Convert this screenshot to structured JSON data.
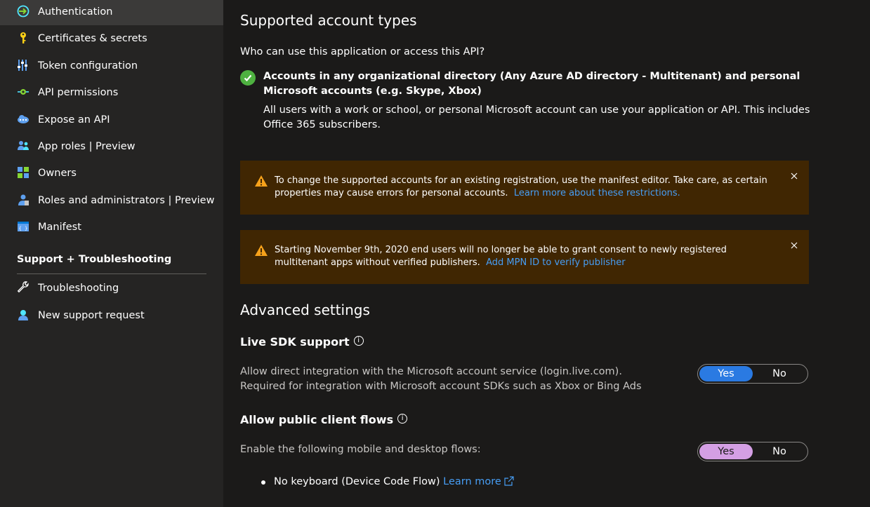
{
  "sidebar": {
    "items": [
      {
        "label": "Authentication",
        "icon": "authentication-icon"
      },
      {
        "label": "Certificates & secrets",
        "icon": "key-icon"
      },
      {
        "label": "Token configuration",
        "icon": "token-bars-icon"
      },
      {
        "label": "API permissions",
        "icon": "api-permissions-icon"
      },
      {
        "label": "Expose an API",
        "icon": "cloud-icon"
      },
      {
        "label": "App roles | Preview",
        "icon": "app-roles-icon"
      },
      {
        "label": "Owners",
        "icon": "owners-grid-icon"
      },
      {
        "label": "Roles and administrators | Preview",
        "icon": "roles-admin-icon"
      },
      {
        "label": "Manifest",
        "icon": "manifest-icon"
      }
    ],
    "support_section": {
      "title": "Support + Troubleshooting",
      "items": [
        {
          "label": "Troubleshooting",
          "icon": "wrench-icon"
        },
        {
          "label": "New support request",
          "icon": "support-person-icon"
        }
      ]
    }
  },
  "main": {
    "supported_accounts": {
      "title": "Supported account types",
      "question": "Who can use this application or access this API?",
      "selected_option": "Accounts in any organizational directory (Any Azure AD directory - Multitenant) and personal Microsoft accounts (e.g. Skype, Xbox)",
      "description": "All users with a work or school, or personal Microsoft account can use your application or API. This includes Office 365 subscribers."
    },
    "banners": [
      {
        "message": "To change the supported accounts for an existing registration, use the manifest editor. Take care, as certain properties may cause errors for personal accounts.",
        "link": "Learn more about these restrictions."
      },
      {
        "message": "Starting November 9th, 2020 end users will no longer be able to grant consent to newly registered multitenant apps without verified publishers.",
        "link": "Add MPN ID to verify publisher"
      }
    ],
    "advanced": {
      "title": "Advanced settings",
      "live_sdk": {
        "title": "Live SDK support",
        "line1": "Allow direct integration with the Microsoft account service (login.live.com).",
        "line2": "Required for integration with Microsoft account SDKs such as Xbox or Bing Ads",
        "yes": "Yes",
        "no": "No",
        "selected": "Yes"
      },
      "public_client": {
        "title": "Allow public client flows",
        "description": "Enable the following mobile and desktop flows:",
        "yes": "Yes",
        "no": "No",
        "selected": "Yes",
        "bullet": "No keyboard (Device Code Flow)",
        "bullet_link": "Learn more"
      }
    }
  },
  "colors": {
    "background": "#1b1a19",
    "sidebar": "#252423",
    "selected_nav": "#3b3a39",
    "warning_banner": "#402602",
    "link": "#479ef5",
    "toggle_blue": "#2a7ae2",
    "toggle_pink": "#d49fe4",
    "success": "#4eb140"
  }
}
